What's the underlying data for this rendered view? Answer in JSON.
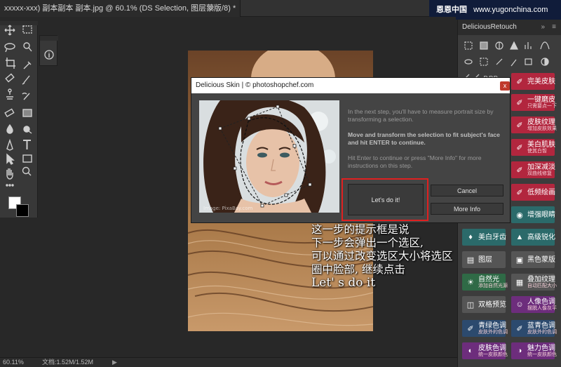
{
  "tab": {
    "title": "xxxxx-xxx) 副本副本 副本.jpg @ 60.1% (DS Selection, 图层蒙版/8) *",
    "close": "×"
  },
  "watermark": {
    "logo": "恩恩中国",
    "url": "www.yugonchina.com"
  },
  "status": {
    "zoom": "60.11%",
    "doc": "文档:1.52M/1.52M",
    "arrow": "▶"
  },
  "panel": {
    "title": "DeliciousRetouch",
    "collapse": "»",
    "menu": "≡",
    "buttons": [
      {
        "label": "完美皮肤",
        "sub": "",
        "color": "red",
        "icon": "brush-icon"
      },
      {
        "label": "一键磨皮",
        "sub": "只需要点一下",
        "color": "red",
        "icon": "brush-icon"
      },
      {
        "label": "皮肤纹理",
        "sub": "增加皮肤效果",
        "color": "red",
        "icon": "brush-icon"
      },
      {
        "label": "美白肌肤",
        "sub": "使其白皙",
        "color": "red",
        "icon": "brush-icon"
      },
      {
        "label": "加深减淡",
        "sub": "双曲线修复",
        "color": "red",
        "icon": "brush-icon"
      },
      {
        "label": "低频绘画",
        "sub": "",
        "color": "red",
        "icon": "brush-icon"
      },
      {
        "label": "增强眼睛",
        "sub": "",
        "color": "teal",
        "icon": "eye-icon"
      },
      {
        "label": "美白牙齿",
        "sub": "",
        "color": "teal",
        "icon": "tooth-icon"
      },
      {
        "label": "高级锐化",
        "sub": "",
        "color": "teal",
        "icon": "sharpen-icon"
      },
      {
        "label": "图层",
        "sub": "",
        "color": "gray",
        "icon": "layer-icon"
      },
      {
        "label": "黑色蒙版",
        "sub": "",
        "color": "gray",
        "icon": "mask-icon"
      },
      {
        "label": "自然光",
        "sub": "添加自然光源",
        "color": "green",
        "icon": "sun-icon"
      },
      {
        "label": "叠加纹理",
        "sub": "自动匹配大小",
        "color": "gray",
        "icon": "texture-icon"
      },
      {
        "label": "双格预览",
        "sub": "",
        "color": "gray",
        "icon": "preview-icon"
      },
      {
        "label": "人像色调",
        "sub": "摆脱人像灰平",
        "color": "purple",
        "icon": "portrait-icon"
      },
      {
        "label": "青绿色调",
        "sub": "皮肤外的色调",
        "color": "blue",
        "icon": "brush-icon"
      },
      {
        "label": "蓝青色调",
        "sub": "皮肤外的色调",
        "color": "blue",
        "icon": "brush-icon"
      },
      {
        "label": "皮肤色调",
        "sub": "统一皮肤颜色",
        "color": "purple",
        "icon": "skin-icon"
      },
      {
        "label": "魅力色调",
        "sub": "统一皮肤颜色",
        "color": "purple",
        "icon": "charm-icon"
      }
    ]
  },
  "dialog": {
    "title": "Delicious Skin | © photoshopchef.com",
    "close": "x",
    "image_credit": "Image: PixaBay.com",
    "text1": "In the next step, you'll have to measure portrait size by transforming a selection.",
    "text2": "Move and transform the selection to fit subject's face and hit ENTER to continue.",
    "text3": "Hit Enter to continue or press \"More Info\" for more instructions on this step.",
    "primary_button": "Let's do it!",
    "cancel_button": "Cancel",
    "more_button": "More Info"
  },
  "annotation": {
    "lines": [
      "这一步的提示框是说",
      "下一步会弹出一个选区,",
      "可以通过改变选区大小将选区",
      "圈中脸部, 继续点击"
    ],
    "english": "Let' s do it"
  },
  "colors": {
    "red": "#b2263e",
    "teal": "#2b6a6a",
    "purple": "#6d2d7c",
    "blue": "#2c4a6e",
    "highlight": "#e02020"
  }
}
